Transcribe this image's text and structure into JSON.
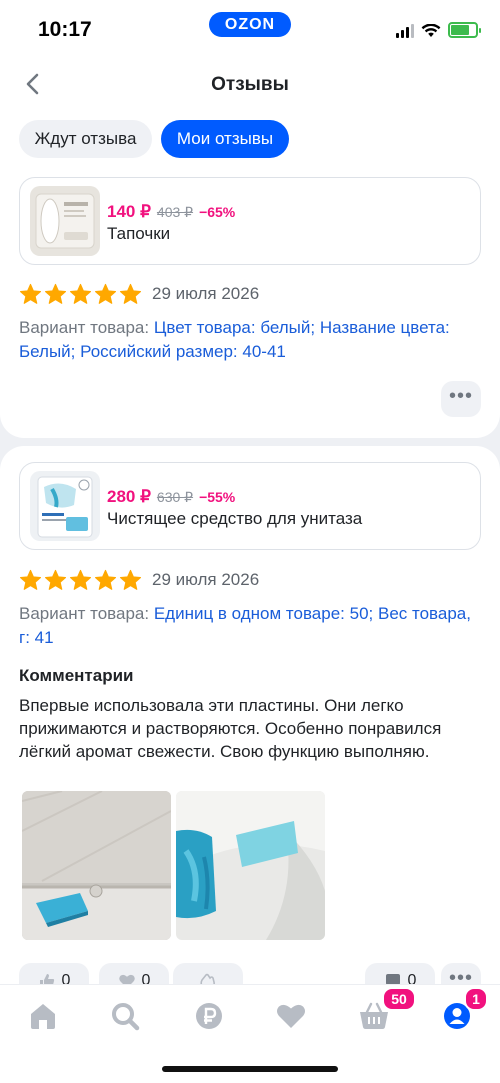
{
  "status_bar": {
    "time": "10:17",
    "brand": "OZON"
  },
  "header": {
    "title": "Отзывы"
  },
  "tabs": [
    {
      "label": "Ждут отзыва",
      "active": false
    },
    {
      "label": "Мои отзывы",
      "active": true
    }
  ],
  "reviews": [
    {
      "product": {
        "price": "140 ₽",
        "old_price": "403 ₽",
        "discount": "−65%",
        "name": "Тапочки"
      },
      "rating": 5,
      "date": "29 июля 2026",
      "variant_label": "Вариант товара:",
      "variant_value": "Цвет товара: белый; Название цвета: Белый; Российский размер: 40-41"
    },
    {
      "product": {
        "price": "280 ₽",
        "old_price": "630 ₽",
        "discount": "−55%",
        "name": "Чистящее средство для унитаза"
      },
      "rating": 5,
      "date": "29 июля 2026",
      "variant_label": "Вариант товара:",
      "variant_value": "Единиц в одном товаре: 50; Вес товара, г: 41",
      "comments_title": "Комментарии",
      "comments_text": "Впервые использовала эти пластины. Они легко прижимаются и растворяются. Особенно понравился лёгкий аромат свежести. Свою функцию выполняю.",
      "reactions": {
        "likes": "0",
        "hearts": "0",
        "comments": "0"
      }
    }
  ],
  "bottom_nav": {
    "items": [
      "home-icon",
      "search-icon",
      "ruble-icon",
      "heart-icon",
      "cart-icon",
      "profile-icon"
    ],
    "cart_badge": "50",
    "profile_badge": "1"
  },
  "colors": {
    "accent": "#005bff",
    "price": "#f1117e",
    "star": "#ffa800"
  }
}
